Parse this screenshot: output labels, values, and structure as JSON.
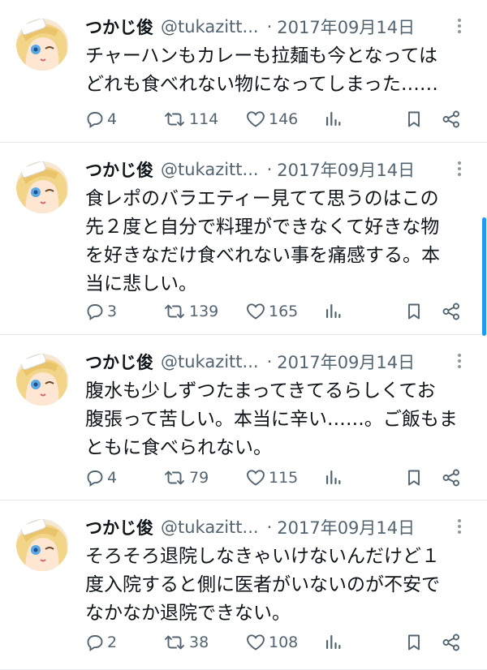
{
  "tweets": [
    {
      "name": "つかじ俊",
      "handle": "@tukazitt...",
      "sep": "·",
      "date": "2017年09月14日",
      "lines": [
        "チャーハンもカレーも拉麺も今となっては",
        "どれも食べれない物になってしまった……"
      ],
      "replies": "4",
      "retweets": "114",
      "likes": "146"
    },
    {
      "name": "つかじ俊",
      "handle": "@tukazitt...",
      "sep": "·",
      "date": "2017年09月14日",
      "lines": [
        "食レポのバラエティー見てて思うのはこの",
        "先２度と自分で料理ができなくて好きな物",
        "を好きなだけ食べれない事を痛感する。本",
        "当に悲しい。"
      ],
      "replies": "3",
      "retweets": "139",
      "likes": "165"
    },
    {
      "name": "つかじ俊",
      "handle": "@tukazitt...",
      "sep": "·",
      "date": "2017年09月14日",
      "lines": [
        "腹水も少しずつたまってきてるらしくてお",
        "腹張って苦しい。本当に辛い……。ご飯もま",
        "ともに食べられない。"
      ],
      "replies": "4",
      "retweets": "79",
      "likes": "115"
    },
    {
      "name": "つかじ俊",
      "handle": "@tukazitt...",
      "sep": "·",
      "date": "2017年09月14日",
      "lines": [
        "そろそろ退院しなきゃいけないんだけど１",
        "度入院すると側に医者がいないのが不安で",
        "なかなか退院できない。"
      ],
      "replies": "2",
      "retweets": "38",
      "likes": "108"
    }
  ],
  "icons": {
    "reply": "speech-bubble-icon",
    "retweet": "retweet-arrows-icon",
    "like": "heart-icon",
    "views": "bar-chart-icon",
    "bookmark": "bookmark-icon",
    "share": "share-nodes-icon",
    "more": "vertical-ellipsis-icon"
  },
  "colors": {
    "text": "#0f1419",
    "muted": "#536471",
    "accent": "#1d9bf0",
    "divider": "#e6e9eb"
  }
}
